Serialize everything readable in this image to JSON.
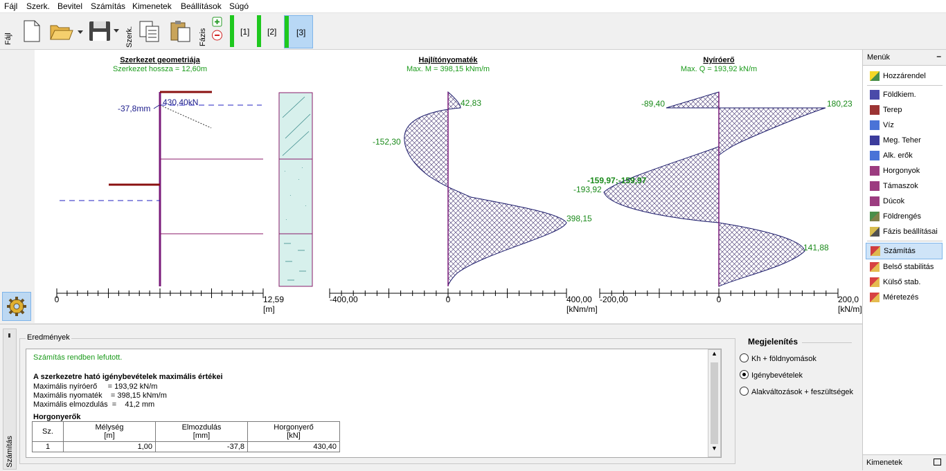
{
  "menu": [
    "Fájl",
    "Szerk.",
    "Bevitel",
    "Számítás",
    "Kimenetek",
    "Beállítások",
    "Súgó"
  ],
  "toolbar": {
    "file_tab": "Fájl",
    "edit_tab": "Szerk.",
    "phase_tab": "Fázis",
    "phases": [
      "[1]",
      "[2]",
      "[3]"
    ]
  },
  "charts": {
    "geometry": {
      "title": "Szerkezet geometriája",
      "subtitle": "Szerkezet hossza = 12,60m",
      "anchor_label": "430,40kN",
      "disp_label": "-37,8mm",
      "axis_left": "0",
      "axis_right": "12,59",
      "unit": "[m]"
    },
    "moment": {
      "title": "Hajlítónyomaték",
      "subtitle": "Max. M = 398,15 kNm/m",
      "v1": "42,83",
      "v2": "-152,30",
      "v3": "398,15",
      "axis_left": "-400,00",
      "axis_mid": "0",
      "axis_right": "400,00",
      "unit": "[kNm/m]"
    },
    "shear": {
      "title": "Nyíróerő",
      "subtitle": "Max. Q = 193,92 kN/m",
      "v1": "-89,40",
      "v2": "180,23",
      "v3": "-159,97;-159,97",
      "v4": "-193,92",
      "v5": "141,88",
      "axis_left": "-200,00",
      "axis_mid": "0",
      "axis_right": "200,0",
      "unit": "[kN/m]"
    }
  },
  "right_panel": {
    "title": "Menük",
    "items": [
      "Hozzárendel",
      "Földkiem.",
      "Terep",
      "Víz",
      "Meg. Teher",
      "Alk. erők",
      "Horgonyok",
      "Támaszok",
      "Dúcok",
      "Földrengés",
      "Fázis beállításai",
      "Számítás",
      "Belső stabilitás",
      "Külső stab.",
      "Méretezés"
    ],
    "bottom": "Kimenetek"
  },
  "bottom": {
    "side_tab": "Számítás",
    "group": "Eredmények",
    "status": "Számítás rendben lefutott.",
    "heading": "A szerkezetre ható igénybevételek maximális értékei",
    "lines": [
      "Maximális nyíróerő     = 193,92 kN/m",
      "Maximális nyomaték    = 398,15 kNm/m",
      "Maximális elmozdulás  =    41,2 mm"
    ],
    "anchor_title": "Horgonyerők",
    "table_headers": [
      [
        "Sz.",
        ""
      ],
      [
        "Mélység",
        "[m]"
      ],
      [
        "Elmozdulás",
        "[mm]"
      ],
      [
        "Horgonyerő",
        "[kN]"
      ]
    ],
    "table_row": [
      "1",
      "1,00",
      "-37,8",
      "430,40"
    ],
    "display_title": "Megjelenítés",
    "options": [
      "Kh + földnyomások",
      "Igénybevételek",
      "Alakváltozások + feszültségek"
    ],
    "selected": 1
  }
}
